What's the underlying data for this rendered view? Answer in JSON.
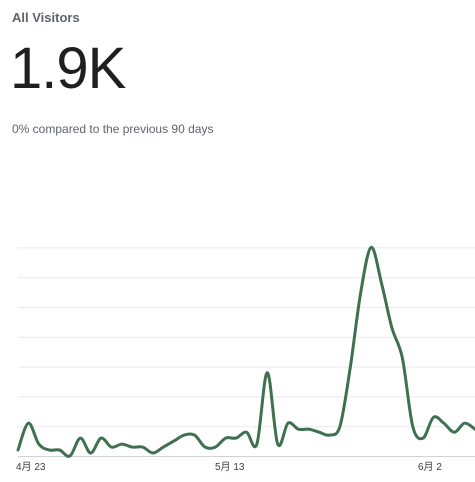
{
  "widget": {
    "title": "All Visitors",
    "total": "1.9K",
    "comparison": "0% compared to the previous 90 days"
  },
  "colors": {
    "line": "#3d7150",
    "grid": "#e8eaed",
    "baseline": "#cfd2d6"
  },
  "chart_data": {
    "type": "line",
    "title": "",
    "xlabel": "",
    "ylabel": "",
    "grid": true,
    "ylim": [
      0,
      100
    ],
    "x_tick_labels": [
      "4月 23",
      "5月 13",
      "6月 2"
    ],
    "series": [
      {
        "values": [
          2,
          11,
          4,
          2,
          2,
          0,
          6,
          1,
          6,
          3,
          4,
          3,
          3,
          1,
          3,
          5,
          7,
          7,
          3,
          3,
          6,
          6,
          8,
          4,
          28,
          4,
          11,
          9,
          9,
          8,
          7,
          10,
          30,
          55,
          70,
          58,
          43,
          33,
          10,
          6,
          13,
          11,
          8,
          11,
          9
        ]
      }
    ]
  }
}
